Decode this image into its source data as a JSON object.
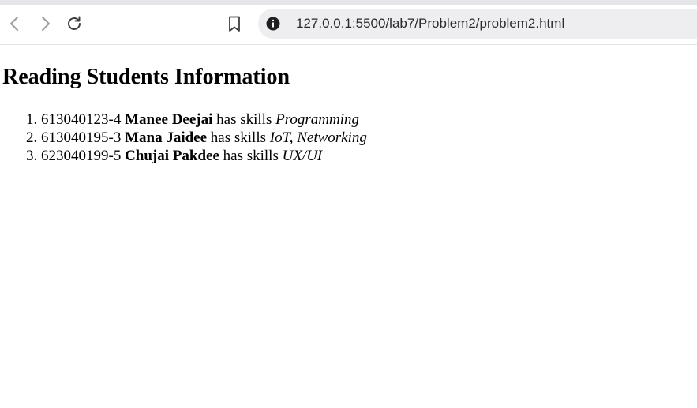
{
  "browser": {
    "url": "127.0.0.1:5500/lab7/Problem2/problem2.html",
    "icons": [
      "back-arrow-icon",
      "forward-arrow-icon",
      "reload-icon",
      "bookmark-icon",
      "site-info-icon"
    ]
  },
  "page": {
    "title": "Reading Students Information",
    "students": [
      {
        "id": "613040123-4",
        "name": "Manee Deejai",
        "connector": "has skills",
        "skills": "Programming"
      },
      {
        "id": "613040195-3",
        "name": "Mana Jaidee",
        "connector": "has skills",
        "skills": "IoT, Networking"
      },
      {
        "id": "623040199-5",
        "name": "Chujai Pakdee",
        "connector": "has skills",
        "skills": "UX/UI"
      }
    ]
  },
  "colors": {
    "address_bar_bg": "#eeeef1",
    "icon_color": "#5f6368",
    "text": "#000000"
  }
}
